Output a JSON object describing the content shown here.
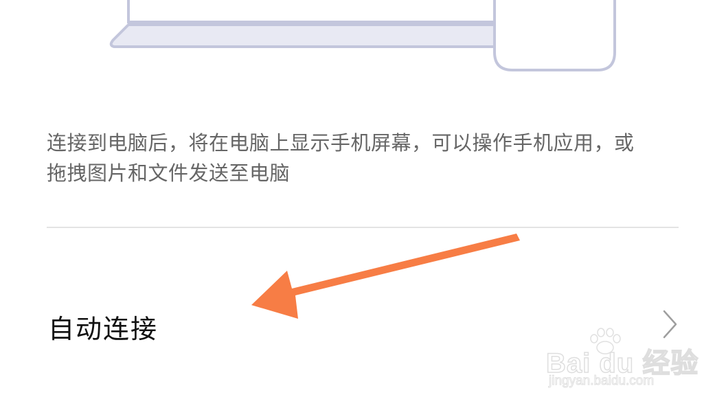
{
  "description": {
    "line1": "连接到电脑后，将在电脑上显示手机屏幕，可以操作手机应用，或",
    "line2": "拖拽图片和文件发送至电脑"
  },
  "setting": {
    "label": "自动连接"
  },
  "watermark": {
    "brand": "Bai du 经验",
    "url": "jingyan.baidu.com"
  },
  "icons": {
    "chevron": "chevron-right-icon",
    "illustration": "laptop-phone-illustration",
    "annotation": "arrow-annotation",
    "watermark_logo": "paw-logo"
  },
  "colors": {
    "illustration_stroke": "#c3c6dc",
    "illustration_fill": "#e8e9f3",
    "annotation_arrow": "#f77d45",
    "text_primary": "#111111",
    "text_secondary": "#666666",
    "divider": "#e3e3e3"
  }
}
